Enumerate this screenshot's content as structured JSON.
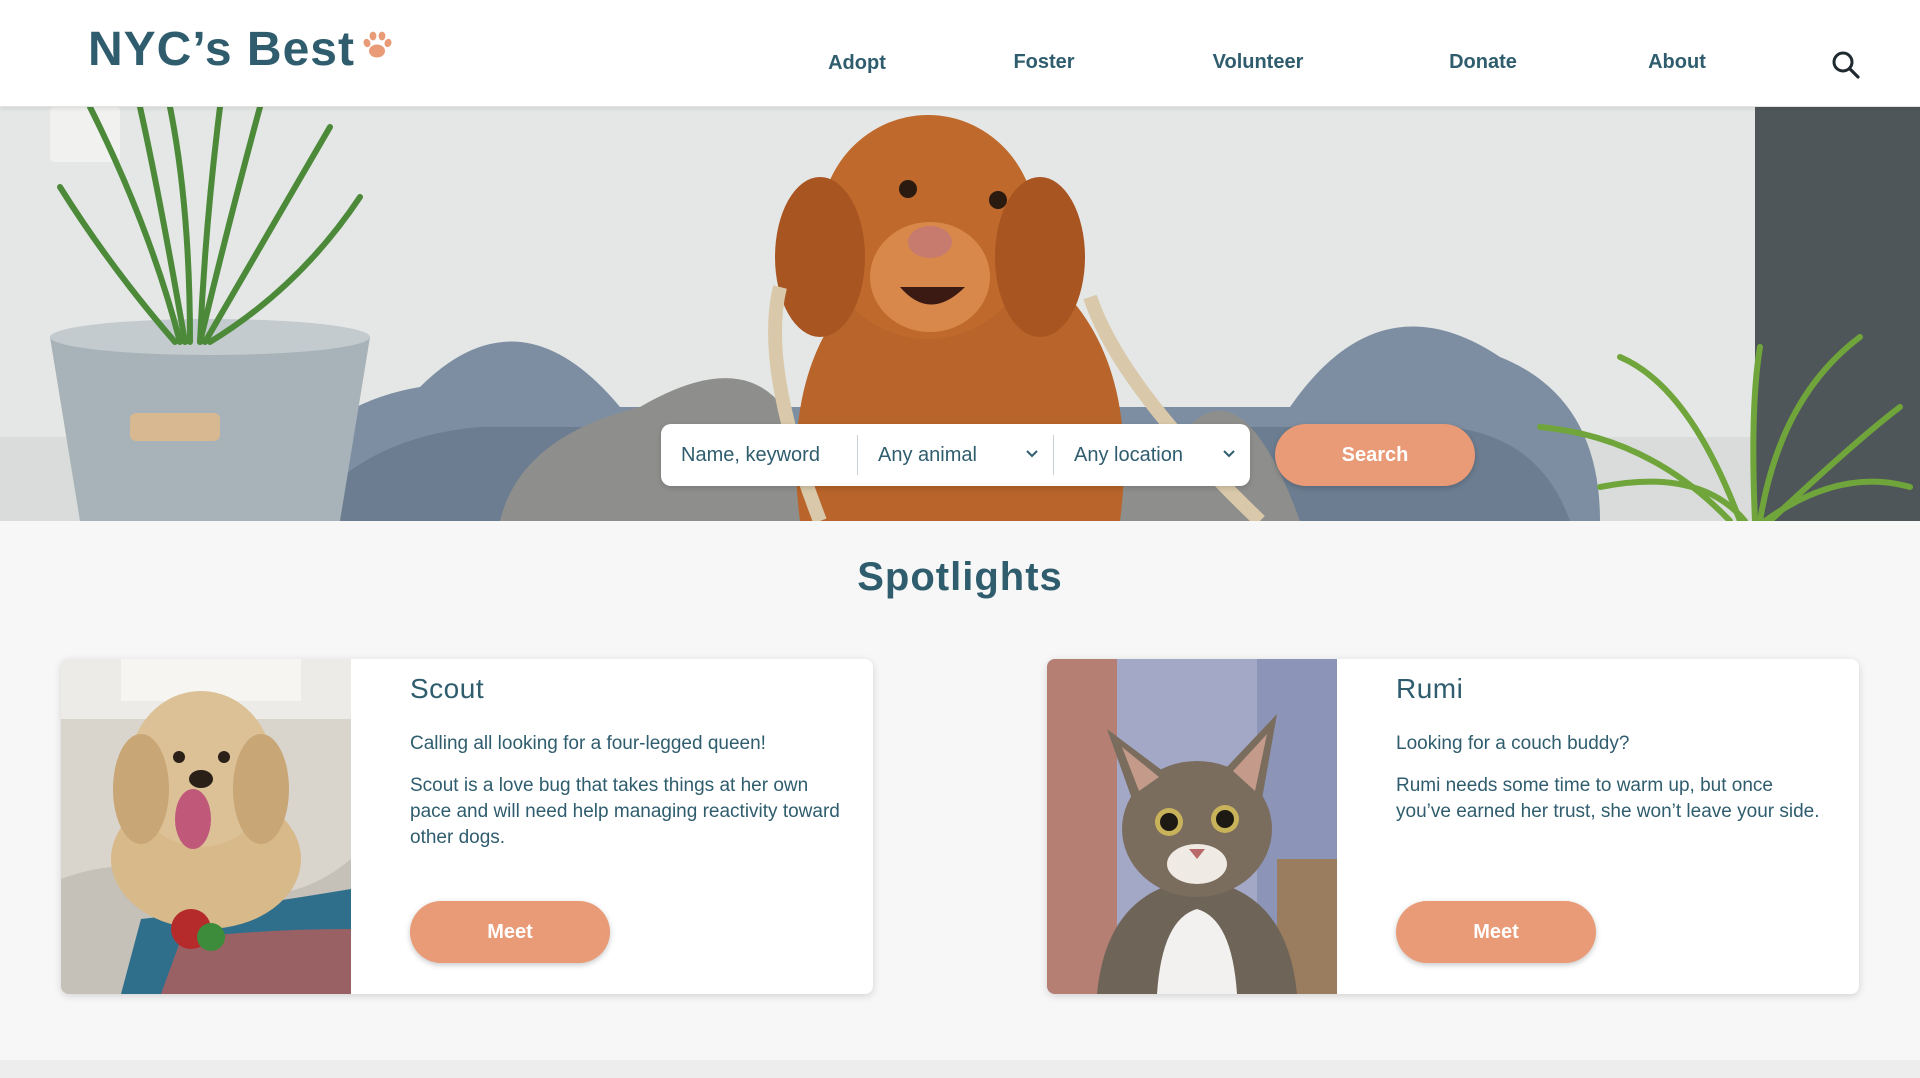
{
  "brand": {
    "name": "NYC’s Best",
    "accent": "#e99a76",
    "primary": "#2f5d6e"
  },
  "nav": {
    "items": [
      {
        "label": "Adopt"
      },
      {
        "label": "Foster"
      },
      {
        "label": "Volunteer"
      },
      {
        "label": "Donate"
      },
      {
        "label": "About"
      }
    ],
    "search_icon": "search-icon"
  },
  "hero_search": {
    "keyword_placeholder": "Name, keyword",
    "animal_value": "Any animal",
    "location_value": "Any location",
    "button_label": "Search"
  },
  "spotlights": {
    "title": "Spotlights",
    "cards": [
      {
        "name": "Scout",
        "tagline": "Calling all looking for a four-legged queen!",
        "description": "Scout is a love bug that takes things at her own pace and will need help managing reactivity toward other dogs.",
        "button_label": "Meet"
      },
      {
        "name": "Rumi",
        "tagline": "Looking for a couch buddy?",
        "description": "Rumi needs some time to warm up, but once you’ve earned her trust, she won’t leave your side.",
        "button_label": "Meet"
      }
    ]
  }
}
